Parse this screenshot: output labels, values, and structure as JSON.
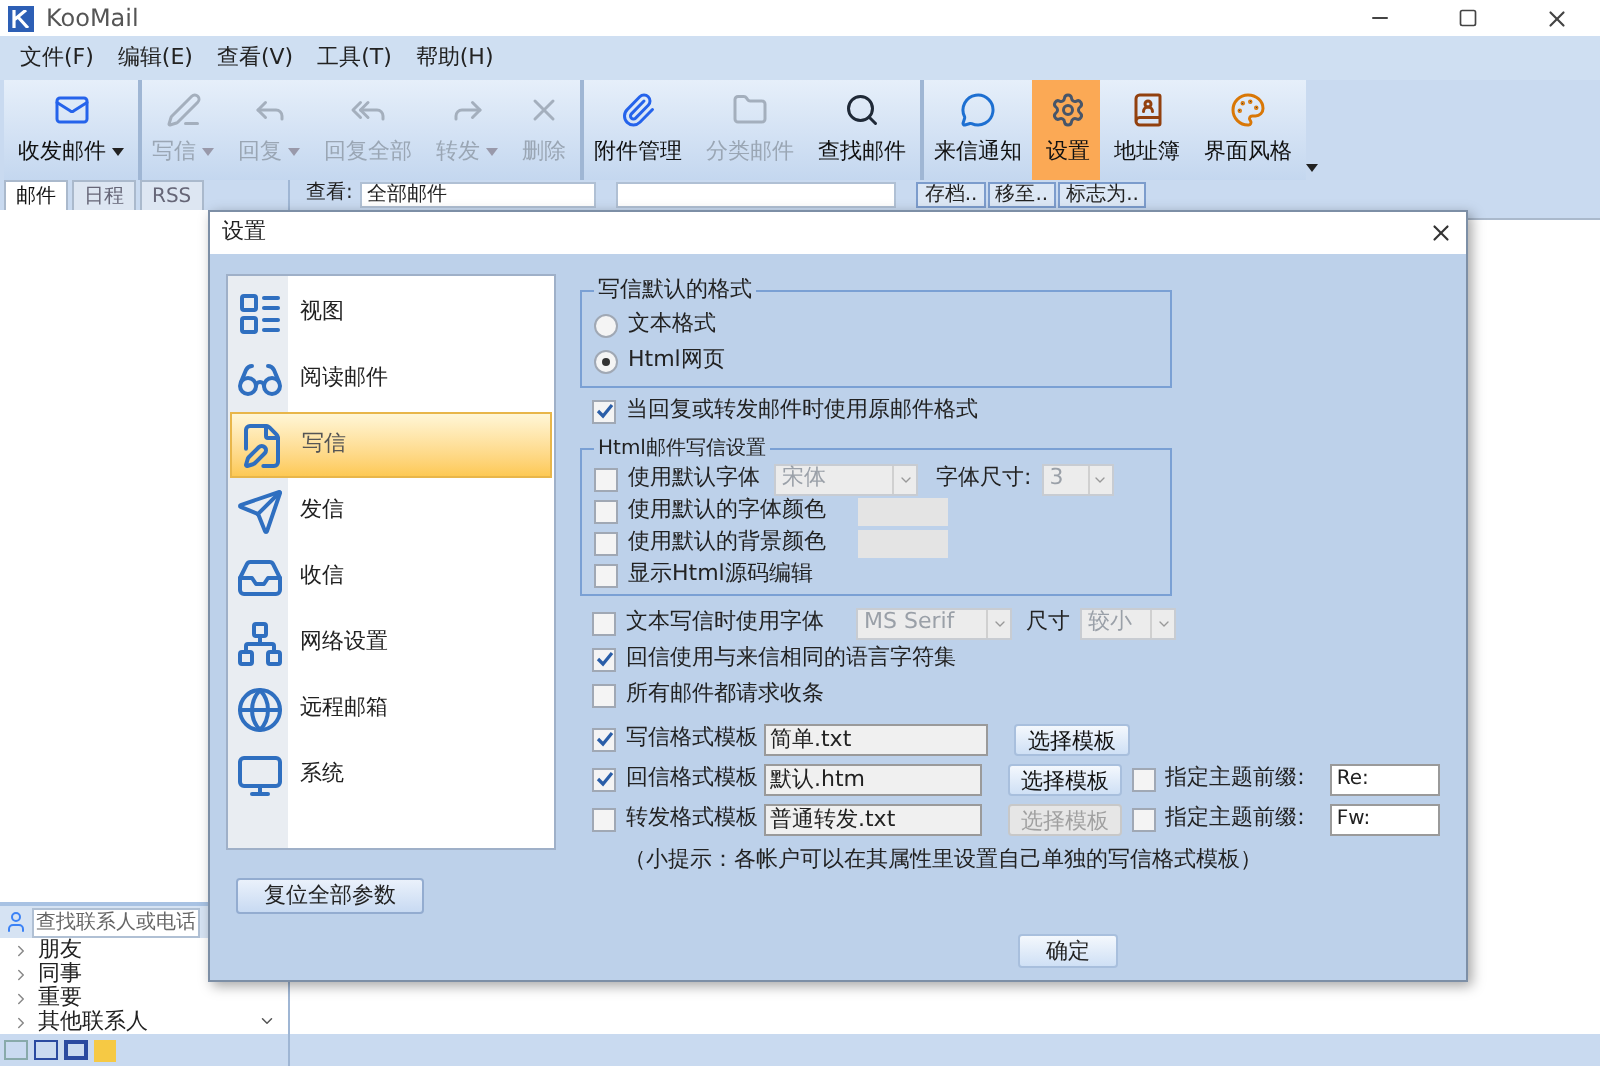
{
  "app": {
    "title": "KooMail"
  },
  "menu": [
    "文件(F)",
    "编辑(E)",
    "查看(V)",
    "工具(T)",
    "帮助(H)"
  ],
  "toolbar": [
    {
      "label": "收发邮件",
      "disabled": false,
      "dropdown": true,
      "selected": false,
      "separator_before": false
    },
    {
      "label": "写信",
      "disabled": true,
      "dropdown": true,
      "selected": false,
      "separator_before": true
    },
    {
      "label": "回复",
      "disabled": true,
      "dropdown": true,
      "selected": false,
      "separator_before": false
    },
    {
      "label": "回复全部",
      "disabled": true,
      "dropdown": false,
      "selected": false,
      "separator_before": false
    },
    {
      "label": "转发",
      "disabled": true,
      "dropdown": true,
      "selected": false,
      "separator_before": false
    },
    {
      "label": "删除",
      "disabled": true,
      "dropdown": false,
      "selected": false,
      "separator_before": false
    },
    {
      "label": "附件管理",
      "disabled": false,
      "dropdown": false,
      "selected": false,
      "separator_before": true
    },
    {
      "label": "分类邮件",
      "disabled": true,
      "dropdown": false,
      "selected": false,
      "separator_before": false
    },
    {
      "label": "查找邮件",
      "disabled": false,
      "dropdown": false,
      "selected": false,
      "separator_before": false
    },
    {
      "label": "来信通知",
      "disabled": false,
      "dropdown": false,
      "selected": false,
      "separator_before": true
    },
    {
      "label": "设置",
      "disabled": false,
      "dropdown": false,
      "selected": true,
      "separator_before": false
    },
    {
      "label": "地址簿",
      "disabled": false,
      "dropdown": false,
      "selected": false,
      "separator_before": false
    },
    {
      "label": "界面风格",
      "disabled": false,
      "dropdown": false,
      "selected": false,
      "separator_before": false
    }
  ],
  "left_tabs": [
    {
      "label": "邮件",
      "selected": true
    },
    {
      "label": "日程",
      "selected": false
    },
    {
      "label": "RSS",
      "selected": false
    }
  ],
  "view_bar": {
    "label": "查看:",
    "filter": "全部邮件",
    "buttons": [
      "存档..",
      "移至..",
      "标志为.."
    ]
  },
  "contacts": {
    "placeholder": "查找联系人或电话",
    "groups": [
      "朋友",
      "同事",
      "重要",
      "其他联系人"
    ]
  },
  "dialog": {
    "title": "设置",
    "nav": [
      {
        "label": "视图",
        "selected": false
      },
      {
        "label": "阅读邮件",
        "selected": false
      },
      {
        "label": "写信",
        "selected": true
      },
      {
        "label": "发信",
        "selected": false
      },
      {
        "label": "收信",
        "selected": false
      },
      {
        "label": "网络设置",
        "selected": false
      },
      {
        "label": "远程邮箱",
        "selected": false
      },
      {
        "label": "系统",
        "selected": false
      }
    ],
    "reset_button": "复位全部参数",
    "ok_button": "确定",
    "format_group": {
      "title": "写信默认的格式",
      "options": [
        {
          "label": "文本格式",
          "selected": false
        },
        {
          "label": "Html网页",
          "selected": true
        }
      ]
    },
    "use_original_format": {
      "label": "当回复或转发邮件时使用原邮件格式",
      "checked": true
    },
    "html_group": {
      "title": "Html邮件写信设置",
      "rows": [
        {
          "kind": "font",
          "label": "使用默认字体",
          "checked": false,
          "font": "宋体",
          "size_label": "字体尺寸:",
          "size": "3"
        },
        {
          "kind": "color",
          "label": "使用默认的字体颜色",
          "checked": false
        },
        {
          "kind": "color",
          "label": "使用默认的背景颜色",
          "checked": false
        },
        {
          "kind": "plain",
          "label": "显示Html源码编辑",
          "checked": false
        }
      ]
    },
    "text_font": {
      "label": "文本写信时使用字体",
      "checked": false,
      "font": "MS Serif",
      "size_label": "尺寸",
      "size": "较小"
    },
    "same_charset": {
      "label": "回信使用与来信相同的语言字符集",
      "checked": true
    },
    "read_receipt": {
      "label": "所有邮件都请求收条",
      "checked": false
    },
    "templates": [
      {
        "label": "写信格式模板",
        "checked": true,
        "file": "简单.txt",
        "button": "选择模板",
        "button_disabled": false
      },
      {
        "label": "回信格式模板",
        "checked": true,
        "file": "默认.htm",
        "button": "选择模板",
        "button_disabled": false,
        "prefix": {
          "label": "指定主题前缀:",
          "checked": false,
          "value": "Re:"
        }
      },
      {
        "label": "转发格式模板",
        "checked": false,
        "file": "普通转发.txt",
        "button": "选择模板",
        "button_disabled": true,
        "prefix": {
          "label": "指定主题前缀:",
          "checked": false,
          "value": "Fw:"
        }
      }
    ],
    "hint": "（小提示：各帐户可以在其属性里设置自己单独的写信格式模板）"
  }
}
